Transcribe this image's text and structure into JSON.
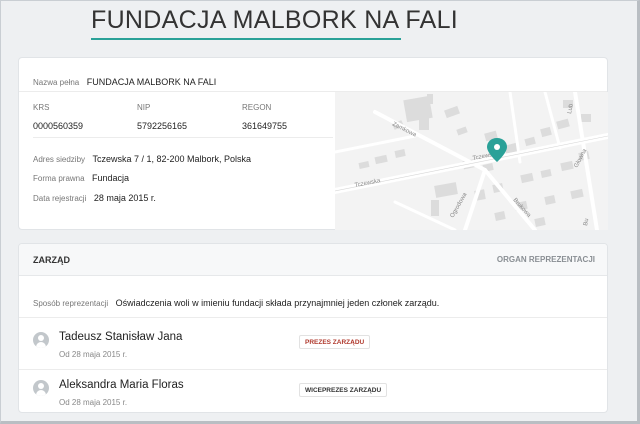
{
  "header": {
    "title": "FUNDACJA MALBORK NA FALI"
  },
  "company": {
    "full_name_label": "Nazwa pełna",
    "full_name": "FUNDACJA MALBORK NA FALI",
    "krs_label": "KRS",
    "krs": "0000560359",
    "nip_label": "NIP",
    "nip": "5792256165",
    "regon_label": "REGON",
    "regon": "361649755",
    "address_label": "Adres siedziby",
    "address": "Tczewska 7 / 1, 82-200 Malbork, Polska",
    "legal_form_label": "Forma prawna",
    "legal_form": "Fundacja",
    "reg_date_label": "Data rejestracji",
    "reg_date": "28 maja 2015 r."
  },
  "map": {
    "streets": [
      "Zamkowa",
      "Tczewska",
      "Tczewska",
      "Brukowa",
      "Ogrodowa",
      "Głowna",
      "Lub",
      "Bu"
    ],
    "pin_color": "#2aa198"
  },
  "board": {
    "title": "ZARZĄD",
    "organ_label": "ORGAN REPREZENTACJI",
    "representation_label": "Sposób reprezentacji",
    "representation": "Oświadczenia woli w imieniu fundacji składa przynajmniej jeden członek zarządu.",
    "members": [
      {
        "name": "Tadeusz Stanisław Jana",
        "since": "Od 28 maja 2015 r.",
        "role": "PREZES ZARZĄDU",
        "role_color": "#b03a2e"
      },
      {
        "name": "Aleksandra Maria Floras",
        "since": "Od 28 maja 2015 r.",
        "role": "WICEPREZES ZARZĄDU",
        "role_color": "#333333"
      }
    ]
  },
  "colors": {
    "accent": "#2aa198",
    "background": "#eef0f2"
  }
}
